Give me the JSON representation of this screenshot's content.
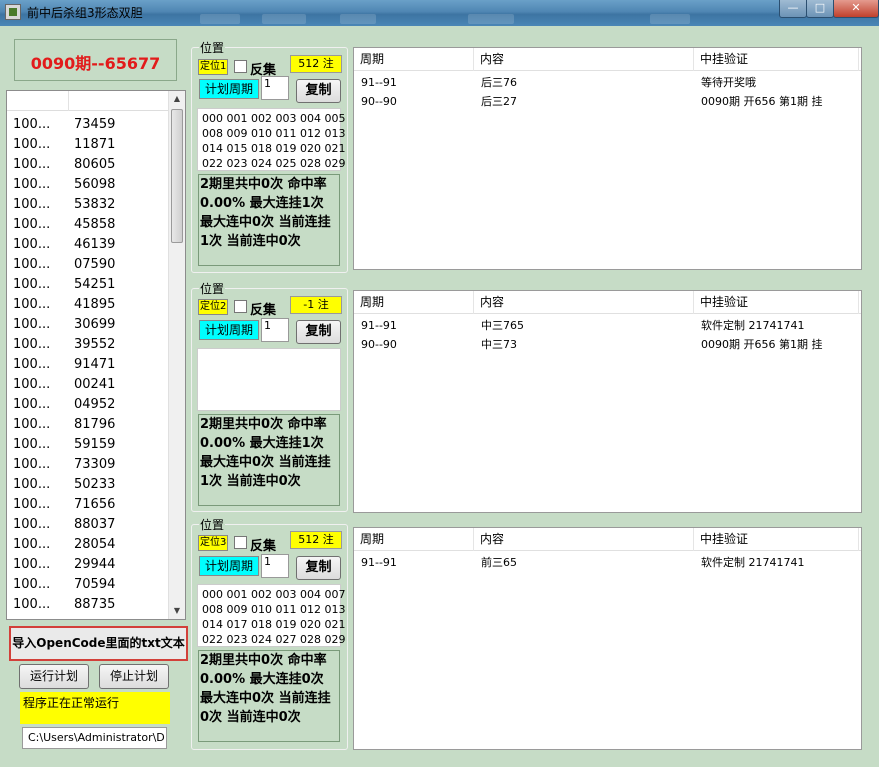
{
  "window": {
    "title": "前中后杀组3形态双胆",
    "minimize": "—",
    "maximize": "□",
    "close": "✕"
  },
  "result": {
    "text": "0090期--65677"
  },
  "history": {
    "rows": [
      [
        "100...",
        "73459"
      ],
      [
        "100...",
        "11871"
      ],
      [
        "100...",
        "80605"
      ],
      [
        "100...",
        "56098"
      ],
      [
        "100...",
        "53832"
      ],
      [
        "100...",
        "45858"
      ],
      [
        "100...",
        "46139"
      ],
      [
        "100...",
        "07590"
      ],
      [
        "100...",
        "54251"
      ],
      [
        "100...",
        "41895"
      ],
      [
        "100...",
        "30699"
      ],
      [
        "100...",
        "39552"
      ],
      [
        "100...",
        "91471"
      ],
      [
        "100...",
        "00241"
      ],
      [
        "100...",
        "04952"
      ],
      [
        "100...",
        "81796"
      ],
      [
        "100...",
        "59159"
      ],
      [
        "100...",
        "73309"
      ],
      [
        "100...",
        "50233"
      ],
      [
        "100...",
        "71656"
      ],
      [
        "100...",
        "88037"
      ],
      [
        "100...",
        "28054"
      ],
      [
        "100...",
        "29944"
      ],
      [
        "100...",
        "70594"
      ],
      [
        "100...",
        "88735"
      ]
    ]
  },
  "controls": {
    "import_label": "导入OpenCode里面的txt文本",
    "run_label": "运行计划",
    "stop_label": "停止计划",
    "status": "程序正在正常运行",
    "path": "C:\\Users\\Administrator\\D"
  },
  "groups": [
    {
      "legend": "位置",
      "position": "定位1",
      "invert_label": "反集",
      "count": "512 注",
      "plan_label": "计划周期",
      "plan_value": "1",
      "copy_label": "复制",
      "numbers": "000 001 002 003 004 005\n008 009 010 011 012 013\n014 015 018 019 020 021\n022 023 024 025 028 029",
      "stats": "2期里共中0次 命中率0.00% 最大连挂1次 最大连中0次 当前连挂1次 当前连中0次"
    },
    {
      "legend": "位置",
      "position": "定位2",
      "invert_label": "反集",
      "count": "-1 注",
      "plan_label": "计划周期",
      "plan_value": "1",
      "copy_label": "复制",
      "numbers": "",
      "stats": "2期里共中0次 命中率0.00% 最大连挂1次 最大连中0次 当前连挂1次 当前连中0次"
    },
    {
      "legend": "位置",
      "position": "定位3",
      "invert_label": "反集",
      "count": "512 注",
      "plan_label": "计划周期",
      "plan_value": "1",
      "copy_label": "复制",
      "numbers": "000 001 002 003 004 007\n008 009 010 011 012 013\n014 017 018 019 020 021\n022 023 024 027 028 029",
      "stats": "2期里共中0次 命中率0.00% 最大连挂0次 最大连中0次 当前连挂0次 当前连中0次"
    }
  ],
  "tables": [
    {
      "headers": [
        "周期",
        "内容",
        "中挂验证"
      ],
      "rows": [
        [
          "91--91",
          "后三76",
          "等待开奖哦"
        ],
        [
          "90--90",
          "后三27",
          "0090期 开656 第1期 挂"
        ]
      ]
    },
    {
      "headers": [
        "周期",
        "内容",
        "中挂验证"
      ],
      "rows": [
        [
          "91--91",
          "中三765",
          "软件定制 21741741"
        ],
        [
          "90--90",
          "中三73",
          "0090期 开656 第1期 挂"
        ]
      ]
    },
    {
      "headers": [
        "周期",
        "内容",
        "中挂验证"
      ],
      "rows": [
        [
          "91--91",
          "前三65",
          "软件定制 21741741"
        ]
      ]
    }
  ]
}
